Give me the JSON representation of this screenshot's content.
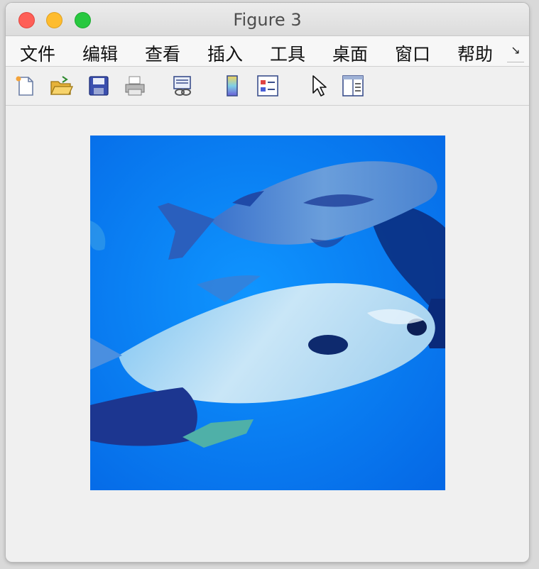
{
  "window": {
    "title": "Figure 3"
  },
  "menu": {
    "items": [
      "文件",
      "编辑",
      "查看",
      "插入",
      "工具",
      "桌面",
      "窗口",
      "帮助"
    ],
    "overflow_glyph": "↘"
  },
  "toolbar": {
    "icons": [
      "new-figure-icon",
      "open-file-icon",
      "save-icon",
      "print-icon",
      "link-plot-icon",
      "colorbar-icon",
      "legend-icon",
      "pointer-icon",
      "property-inspector-icon"
    ]
  },
  "colors": {
    "water": "#0a7ff7",
    "window_bg": "#f0f0f0"
  }
}
